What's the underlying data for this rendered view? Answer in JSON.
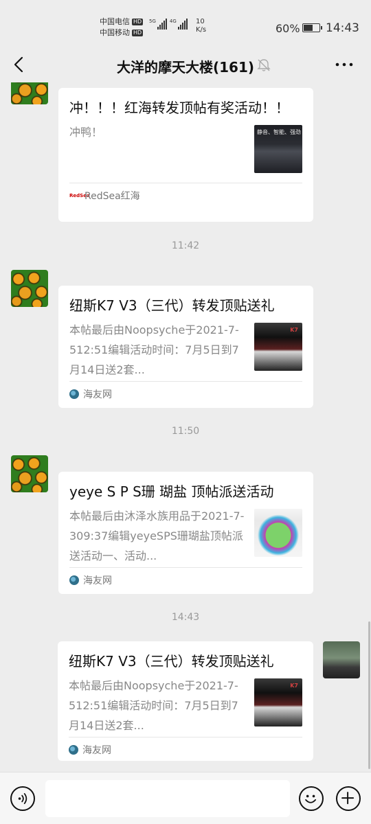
{
  "status": {
    "carrier1": "中国电信",
    "carrier2": "中国移动",
    "hd_badge": "HD",
    "sig1_label": "5G",
    "sig2_label": "4G",
    "speed_value": "10",
    "speed_unit": "K/s",
    "battery_pct": "60%",
    "battery_level": 0.6,
    "time": "14:43"
  },
  "header": {
    "title": "大洋的摩天大楼(161)",
    "more_icon": "more-icon",
    "back_icon": "chevron-left-icon",
    "mute_icon": "bell-muted-icon"
  },
  "messages": [
    {
      "title": "冲！！！红海转发顶帖有奖活动！！",
      "desc": "冲鸭！",
      "thumb_text": "静音、智能、强劲",
      "source": "RedSea红海",
      "source_icon_text": "RedSea"
    },
    {
      "time": "11:42",
      "title": "纽斯K7 V3（三代）转发顶贴送礼",
      "desc": "本帖最后由Noopsyche于2021-7-512:51编辑活动时间：7月5日到7月14日送2套...",
      "thumb_text": "K7",
      "source": "海友网"
    },
    {
      "time": "11:50",
      "title": "yeye S P S珊 瑚盐 顶帖派送活动",
      "desc": "本帖最后由沐泽水族用品于2021-7-309:37编辑yeyeSPS珊瑚盐顶帖派送活动一、活动...",
      "source": "海友网"
    },
    {
      "time": "14:43",
      "title": "纽斯K7 V3（三代）转发顶贴送礼",
      "desc": "本帖最后由Noopsyche于2021-7-512:51编辑活动时间：7月5日到7月14日送2套...",
      "thumb_text": "K7",
      "source": "海友网"
    }
  ],
  "input": {
    "voice_icon": "voice-icon",
    "emoji_icon": "emoji-icon",
    "plus_icon": "plus-icon"
  }
}
